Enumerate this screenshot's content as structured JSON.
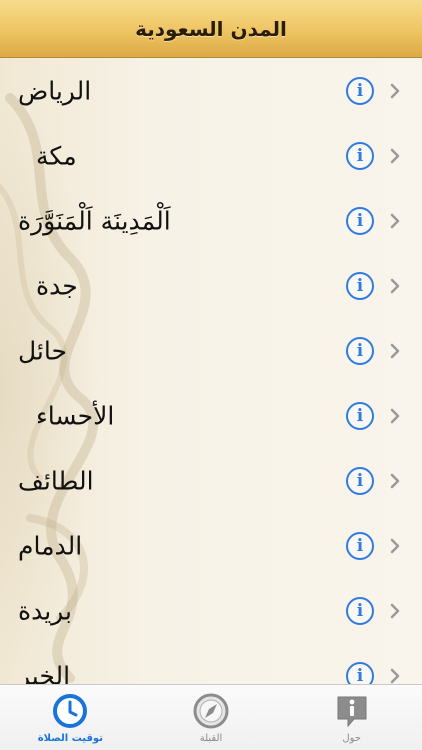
{
  "header": {
    "title": "المدن السعودية"
  },
  "cities": [
    {
      "name": "الرياض",
      "indent": false
    },
    {
      "name": "مكة",
      "indent": true
    },
    {
      "name": "اَلْمَدِينَة اَلْمَنَوَّرَة",
      "indent": false
    },
    {
      "name": "جدة",
      "indent": true
    },
    {
      "name": "حائل",
      "indent": false
    },
    {
      "name": "الأحساء",
      "indent": true
    },
    {
      "name": "الطائف",
      "indent": false
    },
    {
      "name": "الدمام",
      "indent": false
    },
    {
      "name": "بريدة",
      "indent": false
    },
    {
      "name": "الخبر",
      "indent": false
    }
  ],
  "info_icon_glyph": "i",
  "tabs": [
    {
      "label": "توقيت الصلاة",
      "icon": "clock-icon",
      "active": true
    },
    {
      "label": "القبلة",
      "icon": "compass-icon",
      "active": false
    },
    {
      "label": "حول",
      "icon": "info-bubble-icon",
      "active": false
    }
  ],
  "colors": {
    "accent_blue": "#2f7be0",
    "header_gold": "#eec463",
    "background": "#f5efe2"
  }
}
